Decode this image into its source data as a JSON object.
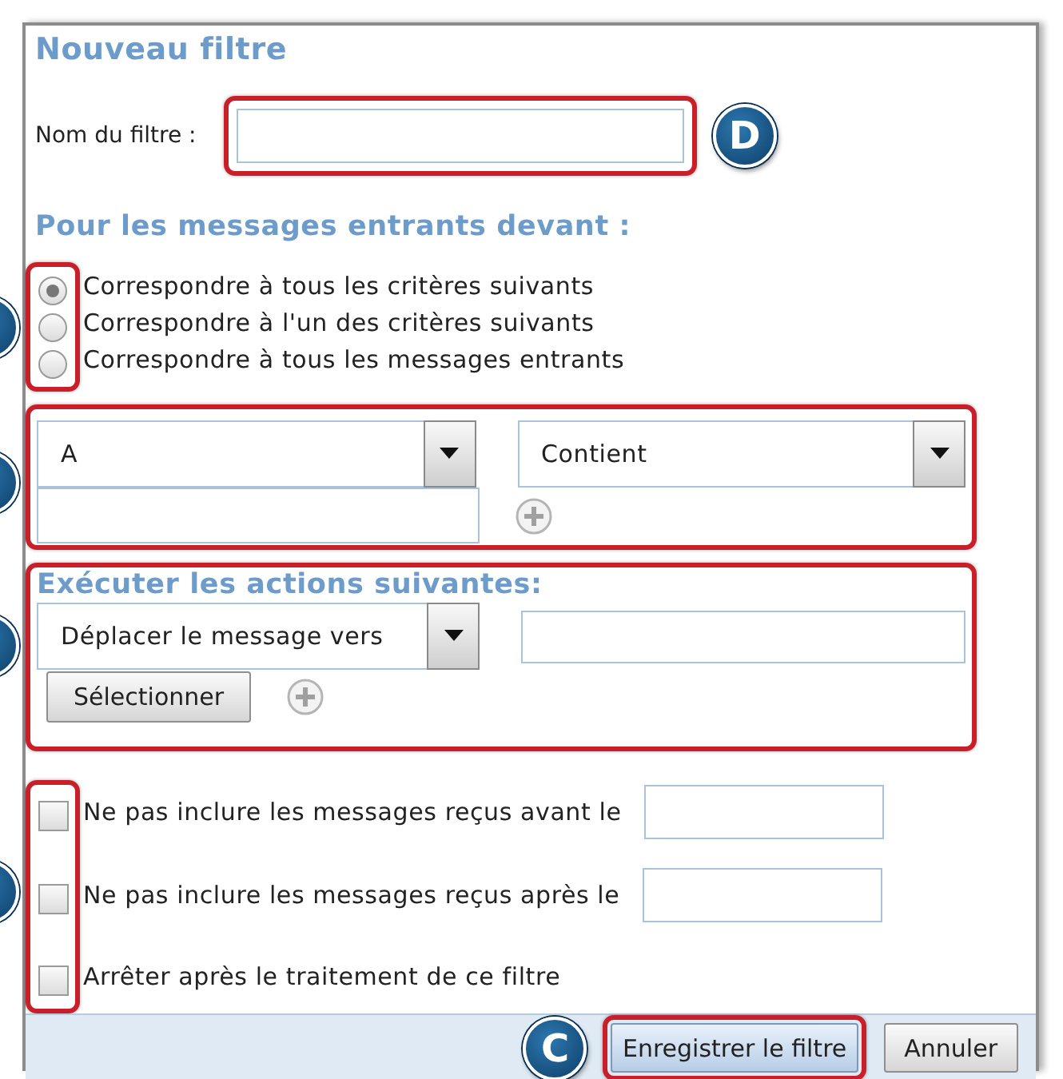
{
  "dialog": {
    "title": "Nouveau filtre"
  },
  "name_field": {
    "label": "Nom du filtre :",
    "highlighted": true,
    "callout": "D"
  },
  "match_section": {
    "heading": "Pour les messages entrants devant :",
    "highlighted": true,
    "options": [
      {
        "label": "Correspondre à tous les critères suivants",
        "selected": true
      },
      {
        "label": "Correspondre à l'un des critères suivants",
        "selected": false
      },
      {
        "label": "Correspondre à tous les messages entrants",
        "selected": false
      }
    ]
  },
  "criteria": {
    "highlighted": true,
    "field": "A",
    "operator": "Contient"
  },
  "actions": {
    "heading": "Exécuter les actions suivantes:",
    "highlighted": true,
    "action": "Déplacer le message vers",
    "select_button": "Sélectionner"
  },
  "options": {
    "highlighted": true,
    "items": [
      {
        "label": "Ne pas inclure les messages reçus avant le",
        "checked": false,
        "kind": "date"
      },
      {
        "label": "Ne pas inclure les messages reçus après le",
        "checked": false,
        "kind": "date"
      },
      {
        "label": "Arrêter après le traitement de ce filtre",
        "checked": false,
        "kind": "plain"
      }
    ]
  },
  "footer": {
    "buttons": [
      {
        "label": "Enregistrer le filtre",
        "kind": "primary",
        "highlighted": true,
        "callout": "C"
      },
      {
        "label": "Annuler",
        "kind": "secondary",
        "highlighted": false
      }
    ]
  }
}
